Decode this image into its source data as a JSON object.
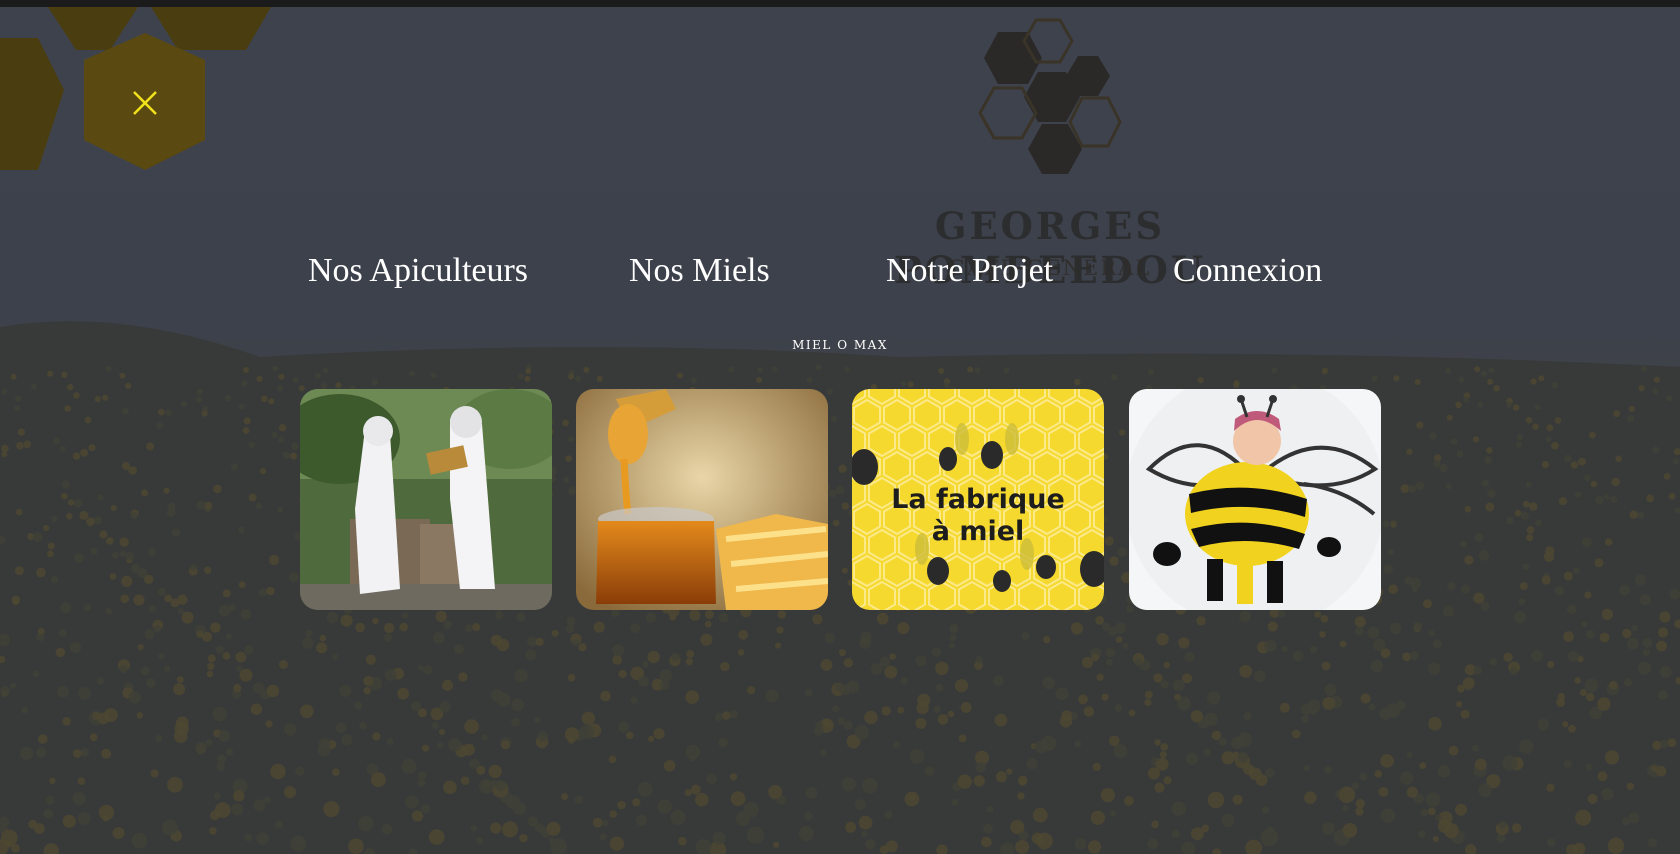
{
  "brand": {
    "title": "GEORGES POMBEEDOU",
    "subtitle": "CAFÉ GÉNÉRAL",
    "logo_icon": "honeycomb-logo-icon"
  },
  "nav": {
    "items": [
      {
        "label": "Nos Apiculteurs",
        "image": "beekeepers-photo"
      },
      {
        "label": "Nos Miels",
        "image": "honey-jar-photo"
      },
      {
        "label": "Notre Projet",
        "image": "la-fabrique-a-miel-graphic"
      },
      {
        "label": "Connexion",
        "image": "bee-child-drawing"
      }
    ]
  },
  "tagline": "MIEL O MAX",
  "card3_text": {
    "line1": "La fabrique",
    "line2": "à miel"
  },
  "close_icon": "close-icon",
  "colors": {
    "accent_yellow": "#f2e11a",
    "hex_gold": "#5a4a12",
    "overlay": "#3f4350",
    "card_yellow": "#f6d92e"
  }
}
